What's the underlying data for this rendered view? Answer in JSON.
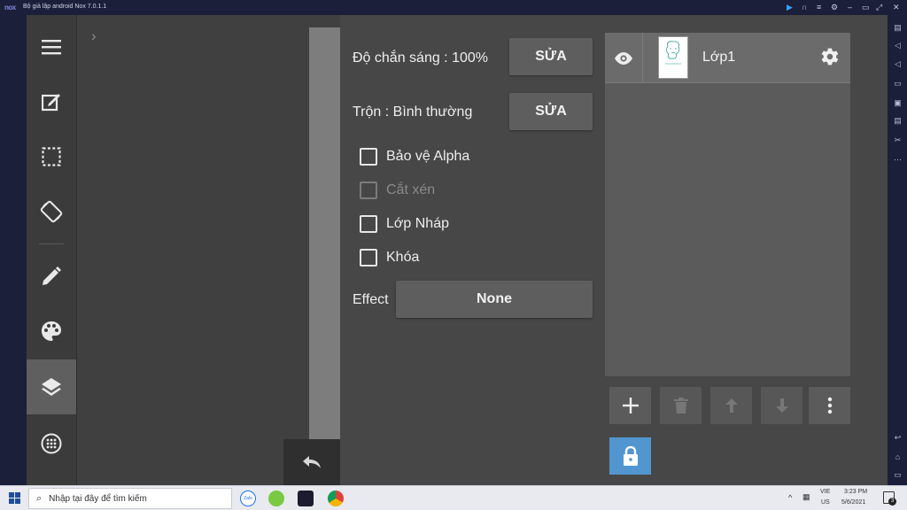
{
  "window": {
    "logo": "nox",
    "title": "Bộ giả lập android Nox 7.0.1.1"
  },
  "panel": {
    "opacity_label": "Độ chắn sáng : 100%",
    "opacity_button": "SỬA",
    "blend_label": "Trộn : Bình thường",
    "blend_button": "SỬA",
    "checkboxes": [
      {
        "label": "Bảo vệ Alpha",
        "checked": false,
        "enabled": true
      },
      {
        "label": "Cắt xén",
        "checked": false,
        "enabled": false
      },
      {
        "label": "Lớp Nháp",
        "checked": false,
        "enabled": true
      },
      {
        "label": "Khóa",
        "checked": false,
        "enabled": true
      }
    ],
    "effect_label": "Effect",
    "effect_value": "None"
  },
  "layers": [
    {
      "name": "Lớp1",
      "visible": true
    }
  ],
  "sidebar": {
    "active": "layers-icon"
  },
  "taskbar": {
    "search_placeholder": "Nhập tại đây để tìm kiếm",
    "lang_top": "VIE",
    "lang_bottom": "US",
    "time": "3:23 PM",
    "date": "5/6/2021",
    "notifications": "3"
  },
  "colors": {
    "accent_lock": "#5296cf",
    "panel_bg": "#474747",
    "button_bg": "#5e5e5e"
  }
}
